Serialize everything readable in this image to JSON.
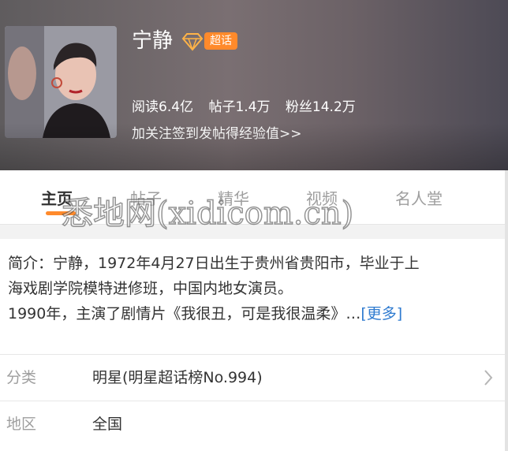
{
  "header": {
    "title": "宁静",
    "badge": "超话",
    "stats": {
      "reads": "阅读6.4亿",
      "posts": "帖子1.4万",
      "fans": "粉丝14.2万"
    },
    "promo": "加关注签到发帖得经验值>>"
  },
  "tabs": [
    {
      "label": "主页"
    },
    {
      "label": "帖子"
    },
    {
      "label": "精华"
    },
    {
      "label": "视频"
    },
    {
      "label": "名人堂"
    }
  ],
  "watermark": "悉地网(xidicom.cn)",
  "intro": {
    "line1": "简介：宁静，1972年4月27日出生于贵州省贵阳市，毕业于上",
    "line2": "海戏剧学院模特进修班，中国内地女演员。",
    "line3": "1990年，主演了剧情片《我很丑，可是我很温柔》…",
    "more": "[更多]"
  },
  "info": {
    "category": {
      "key": "分类",
      "value": "明星(明星超话榜No.994)"
    },
    "region": {
      "key": "地区",
      "value": "全国"
    }
  },
  "colors": {
    "accent": "#ff8a2b",
    "link": "#2f7bd0"
  }
}
